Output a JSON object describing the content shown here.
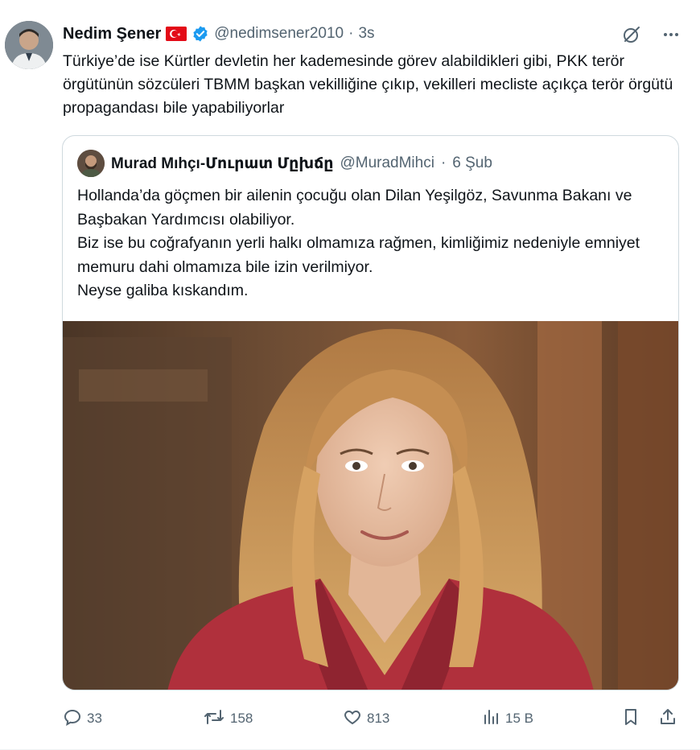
{
  "tweet": {
    "author_name": "Nedim Şener",
    "handle": "@nedimsener2010",
    "separator": "·",
    "time": "3s",
    "text": "Türkiye’de ise Kürtler devletin her kademesinde görev alabildikleri gibi, PKK terör örgütünün sözcüleri TBMM başkan vekilliğine çıkıp, vekilleri mecliste açıkça terör örgütü propagandası bile yapabiliyorlar"
  },
  "quote": {
    "author_name": "Murad Mıhçı-Մուրատ Մըխճը",
    "handle": "@MuradMihci",
    "separator": "·",
    "time": "6 Şub",
    "lines": [
      "Hollanda’da göçmen bir ailenin çocuğu olan Dilan Yeşilgöz, Savunma Bakanı ve Başbakan Yardımcısı olabiliyor.",
      "Biz ise bu coğrafyanın yerli halkı olmamıza rağmen, kimliğimiz nedeniyle emniyet memuru dahi olmamıza bile izin verilmiyor.",
      "Neyse galiba kıskandım."
    ]
  },
  "actions": {
    "replies": "33",
    "retweets": "158",
    "likes": "813",
    "views": "15 B"
  },
  "icons": {
    "flag": "turkey-flag-icon",
    "verified": "verified-badge-icon",
    "grok": "grok-icon",
    "more": "more-icon",
    "reply": "reply-icon",
    "retweet": "retweet-icon",
    "like": "heart-icon",
    "views": "views-icon",
    "bookmark": "bookmark-icon",
    "share": "share-icon"
  },
  "colors": {
    "text": "#0f1419",
    "muted": "#536471",
    "verified": "#1d9bf0",
    "border": "#cfd9de"
  }
}
